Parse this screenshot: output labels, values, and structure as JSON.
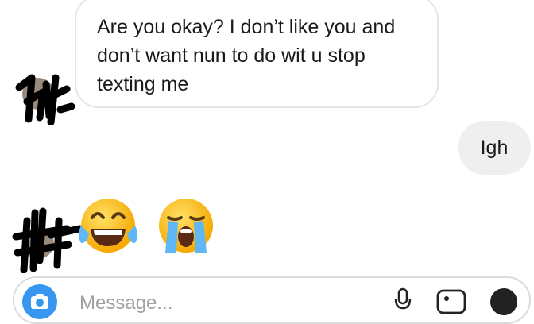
{
  "conversation": {
    "messages": [
      {
        "sender": "other",
        "type": "text",
        "text": "Are you okay? I don’t like you and don’t want nun to do wit u stop texting me"
      },
      {
        "sender": "me",
        "type": "text",
        "text": "Igh"
      },
      {
        "sender": "other",
        "type": "emoji",
        "emojis": [
          "face-with-tears-of-joy",
          "loudly-crying-face"
        ]
      }
    ]
  },
  "composer": {
    "placeholder": "Message...",
    "icons": [
      "camera-icon",
      "microphone-icon",
      "image-icon",
      "sticker-icon"
    ]
  },
  "colors": {
    "accent": "#3797f0",
    "incoming_bubble_border": "#e6e6e6",
    "outgoing_bubble_bg": "#efefef",
    "redaction_ink": "#000000"
  }
}
